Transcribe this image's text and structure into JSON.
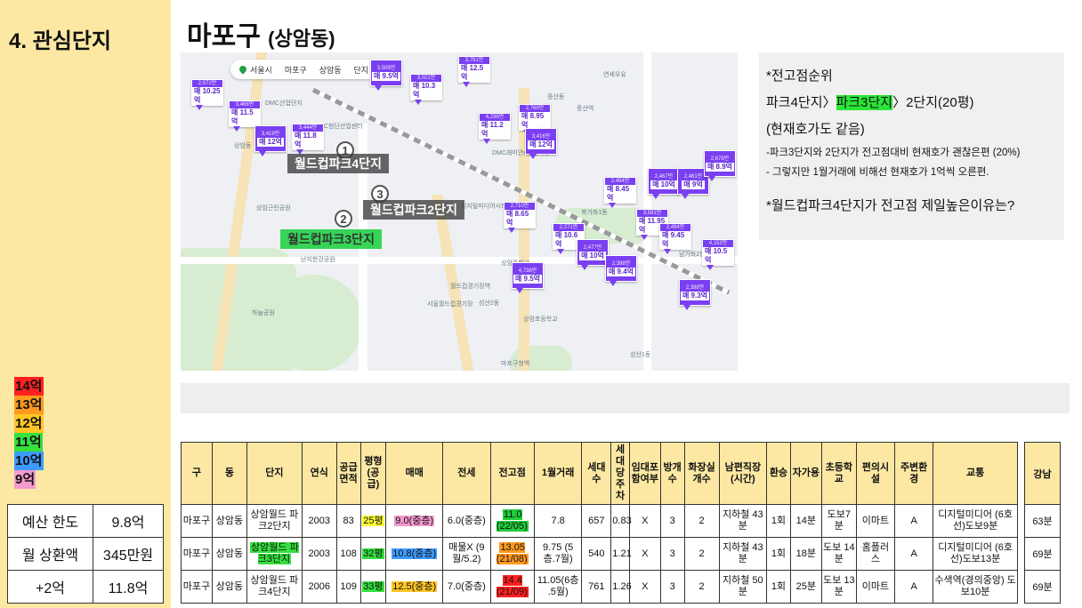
{
  "section_title": "4. 관심단지",
  "title": {
    "main": "마포구",
    "sub": "(상암동)"
  },
  "price_legend": [
    {
      "label": "14억",
      "color": "#ff2020"
    },
    {
      "label": "13억",
      "color": "#ff9a1f"
    },
    {
      "label": "12억",
      "color": "#ffc524"
    },
    {
      "label": "11억",
      "color": "#35e03f"
    },
    {
      "label": "10억",
      "color": "#3d9bff"
    },
    {
      "label": "9억",
      "color": "#f49ad0"
    }
  ],
  "budget": [
    {
      "label": "예산 한도",
      "value": "9.8억"
    },
    {
      "label": "월 상환액",
      "value": "345만원"
    },
    {
      "label": "+2억",
      "value": "11.8억"
    }
  ],
  "map": {
    "breadcrumb": [
      "서울시",
      "마포구",
      "상암동",
      "단지"
    ],
    "place_labels": [
      "월드컵파크4단지",
      "월드컵파크2단지",
      "월드컵파크3단지"
    ],
    "place_numbers": [
      "1",
      "3",
      "2"
    ],
    "markers": [
      {
        "price": "매 9.5억",
        "tag": "3,509만"
      },
      {
        "price": "매 10.3억",
        "tag": "3,021만"
      },
      {
        "price": "매 12.5억",
        "tag": "3,791만"
      },
      {
        "price": "매 10.25억",
        "tag": "2,572만"
      },
      {
        "price": "매 11.5억",
        "tag": "3,468만"
      },
      {
        "price": "매 12억",
        "tag": "3,419만"
      },
      {
        "price": "매 11.8억",
        "tag": "3,444만"
      },
      {
        "price": "매 11.2억",
        "tag": "4,236만"
      },
      {
        "price": "매 8.95억",
        "tag": "2,769만"
      },
      {
        "price": "매 12억",
        "tag": "3,416만"
      },
      {
        "price": "매 8.65억",
        "tag": "2,710만"
      },
      {
        "price": "매 8.45억",
        "tag": "2,494만"
      },
      {
        "price": "매 10억",
        "tag": "2,467만"
      },
      {
        "price": "매 9억",
        "tag": "2,461만"
      },
      {
        "price": "매 8.9억",
        "tag": "2,679만"
      },
      {
        "price": "매 11.95억",
        "tag": "3,591만"
      },
      {
        "price": "매 9.45억",
        "tag": "2,494만"
      },
      {
        "price": "매 10.6억",
        "tag": "2,271만"
      },
      {
        "price": "매 10억",
        "tag": "2,477만"
      },
      {
        "price": "매 9.4억",
        "tag": "2,398만"
      },
      {
        "price": "매 9.5억",
        "tag": "4,738만"
      },
      {
        "price": "매 10.5억",
        "tag": "4,152만"
      },
      {
        "price": "매 9.3억",
        "tag": "2,398만"
      }
    ],
    "names": [
      "연세우유",
      "증산동",
      "증산역",
      "DMC산업단지",
      "DMC첨단산업센터",
      "DMC래미안e편한세상",
      "디지털미디어시티",
      "상암동",
      "상암근린공원",
      "하늘공원",
      "월드컵경기장역",
      "서울월드컵경기장",
      "성산2동",
      "상암중학교",
      "상암초등학교",
      "마포구청역",
      "난지한강공원",
      "북가좌1동",
      "남가좌2동",
      "성산1동"
    ]
  },
  "notes": {
    "heading": "*전고점순위",
    "ranking_prefix": "파크4단지〉",
    "ranking_highlight": "파크3단지",
    "ranking_suffix": "〉2단지(20평)",
    "ranking_note": "(현재호가도 같음)",
    "detail_1": "-파크3단지와 2단지가 전고점대비 현재호가 괜찮은편 (20%)",
    "detail_2": "- 그렇지만 1월거래에 비해선 현재호가 1억씩 오른편.",
    "question": "*월드컵파크4단지가 전고점 제일높은이유는?"
  },
  "table": {
    "headers": [
      "구",
      "동",
      "단지",
      "연식",
      "공급면적",
      "평형(공급)",
      "매매",
      "전세",
      "전고점",
      "1월거래",
      "세대수",
      "세대당주차",
      "임대포함여부",
      "방개수",
      "화장실개수",
      "남편직장(시간)",
      "환승",
      "자가용",
      "초등학교",
      "편의시설",
      "주변환경",
      "교통"
    ],
    "rows": [
      [
        "마포구",
        "상암동",
        "상암월드 파크2단지",
        "2003",
        "83",
        "25평",
        "9.0(중층)",
        "6.0(중층)",
        "11.0 (22/05)",
        "7.8",
        "657",
        "0.83",
        "X",
        "3",
        "2",
        "지하철 43분",
        "1회",
        "14분",
        "도보7분",
        "이마트",
        "A",
        "디지털미디어 (6호선)도보9분"
      ],
      [
        "마포구",
        "상암동",
        "상암월드 파크3단지",
        "2003",
        "108",
        "32평",
        "10.8(중층)",
        "매물X (9월/5.2)",
        "13.05 (21/08)",
        "9.75 (5층.7월)",
        "540",
        "1.21",
        "X",
        "3",
        "2",
        "지하철 43분",
        "1회",
        "18분",
        "도보 14분",
        "홈플러스",
        "A",
        "디지털미디어 (6호선)도보13분"
      ],
      [
        "마포구",
        "상암동",
        "상암월드 파크4단지",
        "2006",
        "109",
        "33평",
        "12.5(중층)",
        "7.0(중층)",
        "14.4 (21/09)",
        "11.05(6층 .5월)",
        "761",
        "1.26",
        "X",
        "3",
        "2",
        "지하철 50분",
        "1회",
        "25분",
        "도보 13분",
        "이마트",
        "A",
        "수색역(경의중앙) 도보10분"
      ]
    ]
  },
  "side_table": {
    "header": "강남",
    "values": [
      "63분",
      "69분",
      "69분"
    ]
  }
}
